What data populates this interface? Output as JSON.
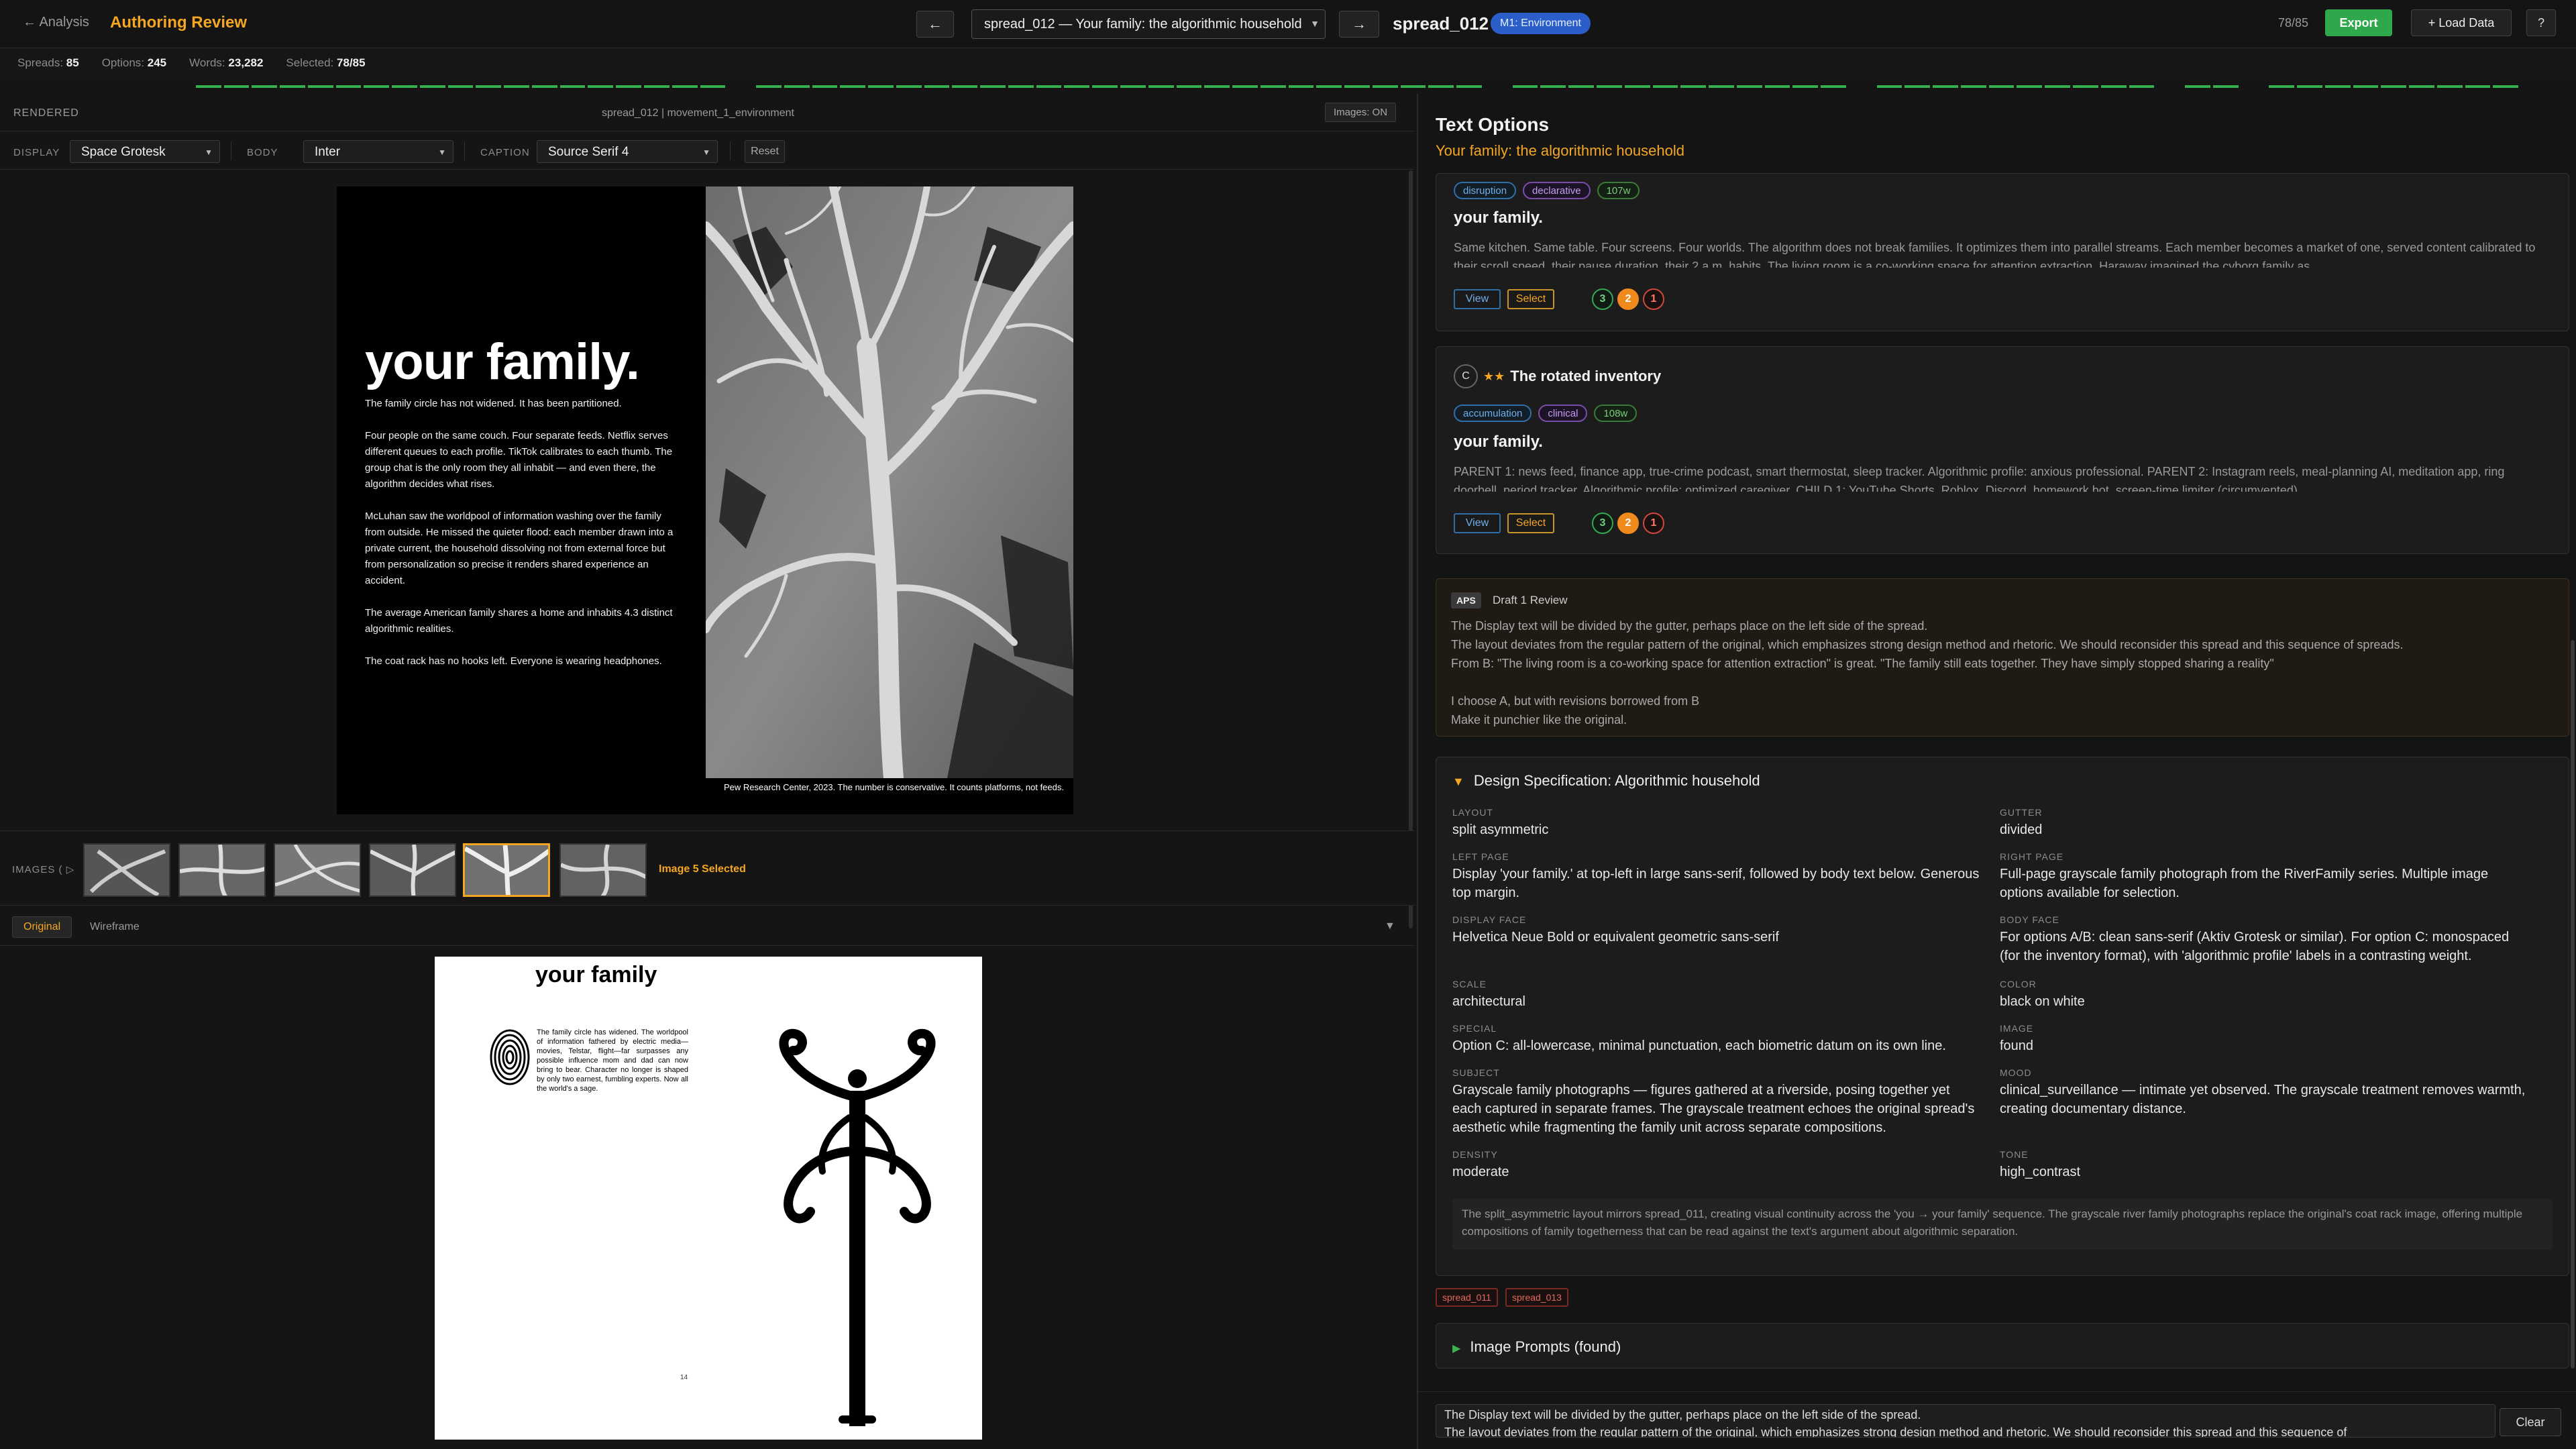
{
  "topbar": {
    "back": "← Analysis",
    "title": "Authoring Review",
    "prev": "←",
    "next": "→",
    "spread_select": "spread_012 — Your family: the algorithmic household",
    "spread_id": "spread_012",
    "movement_badge": "M1: Environment",
    "position": "78/85",
    "export": "Export",
    "load": "+ Load Data",
    "help": "?"
  },
  "stats": {
    "spreads_label": "Spreads:",
    "spreads": "85",
    "options_label": "Options:",
    "options": "245",
    "words_label": "Words:",
    "words": "23,282",
    "selected_label": "Selected:",
    "selected": "78/85"
  },
  "render": {
    "label": "RENDERED",
    "info": "spread_012 | movement_1_environment",
    "images_toggle": "Images: ON"
  },
  "fonts": {
    "display_label": "DISPLAY",
    "display": "Space Grotesk",
    "body_label": "BODY",
    "body": "Inter",
    "caption_label": "CAPTION",
    "caption": "Source Serif 4",
    "reset": "Reset"
  },
  "spread": {
    "title": "your family.",
    "paragraphs": [
      "The family circle has not widened. It has been partitioned.",
      "Four people on the same couch. Four separate feeds. Netflix serves different queues to each profile. TikTok calibrates to each thumb. The group chat is the only room they all inhabit — and even there, the algorithm decides what rises.",
      "McLuhan saw the worldpool of information washing over the family from outside. He missed the quieter flood: each member drawn into a private current, the household dissolving not from external force but from personalization so precise it renders shared experience an accident.",
      "The average American family shares a home and inhabits 4.3 distinct algorithmic realities.",
      "The coat rack has no hooks left. Everyone is wearing headphones."
    ],
    "caption": "Pew Research Center, 2023. The number is conservative. It counts platforms, not feeds."
  },
  "images": {
    "label": "IMAGES",
    "selected_text": "Image 5 Selected",
    "thumb_count": 6,
    "selected_index": 5
  },
  "view_tabs": {
    "original": "Original",
    "wireframe": "Wireframe",
    "collapse": "▼"
  },
  "original": {
    "title": "your family",
    "body": "The family circle has widened. The worldpool of information fathered by electric media—movies, Telstar, flight—far surpasses any possible influence mom and dad can now bring to bear. Character no longer is shaped by only two earnest, fumbling experts. Now all the world's a sage.",
    "page_number": "14"
  },
  "right": {
    "heading": "Text Options",
    "subtitle": "Your family: the algorithmic household"
  },
  "option_a": {
    "tags": [
      "disruption",
      "declarative",
      "107w"
    ],
    "family": "your family.",
    "text": "Same kitchen. Same table. Four screens. Four worlds. The algorithm does not break families. It optimizes them into parallel streams. Each member becomes a market of one, served content calibrated to their scroll speed, their pause duration, their 2 a.m. habits. The living room is a co-working space for attention extraction. Haraway imagined the cyborg family as",
    "view": "View",
    "select": "Select",
    "scores": [
      "3",
      "2",
      "1"
    ]
  },
  "option_b": {
    "letter": "C",
    "stars": "★★",
    "name": "The rotated inventory",
    "tags": [
      "accumulation",
      "clinical",
      "108w"
    ],
    "family": "your family.",
    "text": "PARENT 1: news feed, finance app, true-crime podcast, smart thermostat, sleep tracker. Algorithmic profile: anxious professional. PARENT 2: Instagram reels, meal-planning AI, meditation app, ring doorbell, period tracker. Algorithmic profile: optimized caregiver. CHILD 1: YouTube Shorts, Roblox, Discord, homework bot, screen-time limiter (circumvented).",
    "view": "View",
    "select": "Select",
    "scores": [
      "3",
      "2",
      "1"
    ]
  },
  "review": {
    "badge": "APS",
    "title": "Draft 1 Review",
    "lines": [
      "The Display text will be divided by the gutter, perhaps place on the left side of the spread.",
      "The layout deviates from the regular pattern of the original, which emphasizes strong design method and rhetoric. We should reconsider this spread and this sequence of spreads.",
      "From B: \"The living room is a co-working space for attention extraction\" is great. \"The family still eats together. They have simply stopped sharing a reality\"",
      "",
      "I choose A, but with revisions borrowed from B",
      "Make it punchier like the original."
    ]
  },
  "spec": {
    "heading": "Design Specification: Algorithmic household",
    "fields": [
      {
        "label": "LAYOUT",
        "value": "split asymmetric"
      },
      {
        "label": "GUTTER",
        "value": "divided"
      },
      {
        "label": "LEFT PAGE",
        "value": "Display 'your family.' at top-left in large sans-serif, followed by body text below. Generous top margin."
      },
      {
        "label": "RIGHT PAGE",
        "value": "Full-page grayscale family photograph from the RiverFamily series. Multiple image options available for selection."
      },
      {
        "label": "DISPLAY FACE",
        "value": "Helvetica Neue Bold or equivalent geometric sans-serif"
      },
      {
        "label": "BODY FACE",
        "value": "For options A/B: clean sans-serif (Aktiv Grotesk or similar). For option C: monospaced (for the inventory format), with 'algorithmic profile' labels in a contrasting weight."
      },
      {
        "label": "SCALE",
        "value": "architectural"
      },
      {
        "label": "COLOR",
        "value": "black on white"
      },
      {
        "label": "SPECIAL",
        "value": "Option C: all-lowercase, minimal punctuation, each biometric datum on its own line."
      },
      {
        "label": "IMAGE",
        "value": "found"
      },
      {
        "label": "SUBJECT",
        "value": "Grayscale family photographs — figures gathered at a riverside, posing together yet each captured in separate frames. The grayscale treatment echoes the original spread's aesthetic while fragmenting the family unit across separate compositions."
      },
      {
        "label": "MOOD",
        "value": "clinical_surveillance — intimate yet observed. The grayscale treatment removes warmth, creating documentary distance."
      },
      {
        "label": "DENSITY",
        "value": "moderate"
      },
      {
        "label": "TONE",
        "value": "high_contrast"
      }
    ],
    "note": "The split_asymmetric layout mirrors spread_011, creating visual continuity across the 'you → your family' sequence. The grayscale river family photographs replace the original's coat rack image, offering multiple compositions of family togetherness that can be read against the text's argument about algorithmic separation."
  },
  "refs": [
    "spread_011",
    "spread_013"
  ],
  "image_prompts": {
    "label": "Image Prompts (found)"
  },
  "notes_box": {
    "text": "The Display text will be divided by the gutter, perhaps place on the left side of the spread.\nThe layout deviates from the regular pattern of the original, which emphasizes strong design method and rhetoric. We should reconsider this spread and this sequence of",
    "clear": "Clear"
  },
  "colors": {
    "accent": "#f5a623",
    "success": "#34b04f",
    "badge": "#2b5ec8"
  }
}
